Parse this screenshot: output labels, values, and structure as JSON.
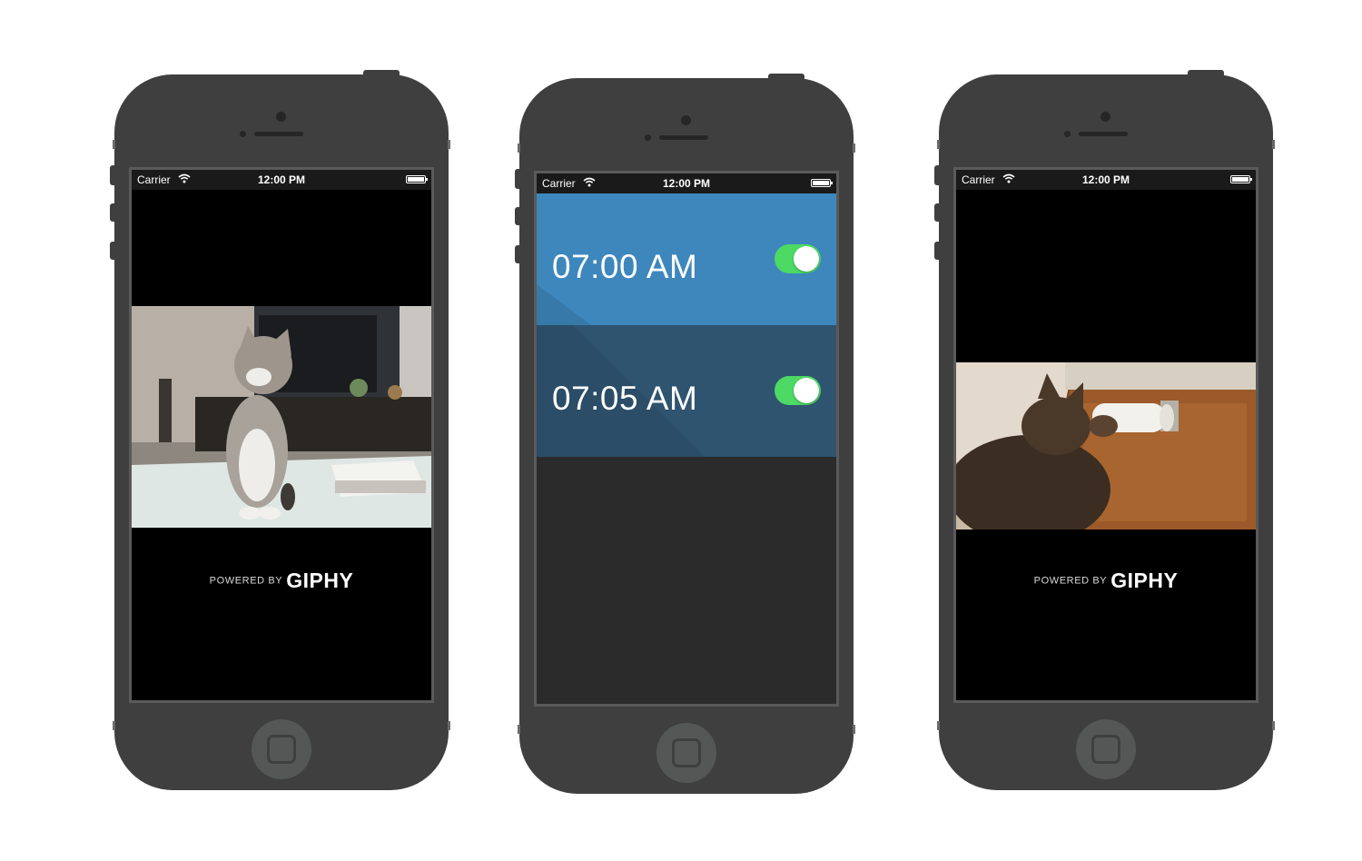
{
  "status_bar": {
    "carrier": "Carrier",
    "time": "12:00 PM"
  },
  "giphy": {
    "powered_by": "POWERED BY",
    "brand": "GIPHY"
  },
  "alarms": [
    {
      "time": "07:00 AM",
      "enabled": true,
      "color": "#3e87bd"
    },
    {
      "time": "07:05 AM",
      "enabled": true,
      "color": "#2f5470"
    }
  ],
  "colors": {
    "phone_body": "#3f3f3f",
    "toggle_on": "#4cd964",
    "app_background": "#2b2b2b"
  },
  "icons": [
    "wifi-icon",
    "battery-icon",
    "home-button-icon"
  ]
}
